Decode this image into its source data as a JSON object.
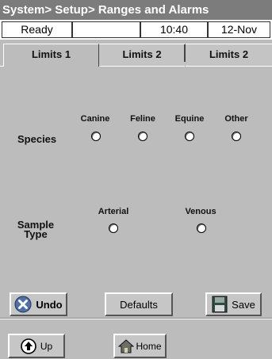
{
  "title": "System> Setup> Ranges and Alarms",
  "status": {
    "state": "Ready",
    "blank": "",
    "time": "10:40",
    "date": "12-Nov"
  },
  "tabs": [
    {
      "label": "Limits 1",
      "active": true
    },
    {
      "label": "Limits 2",
      "active": false
    },
    {
      "label": "Limits 2",
      "active": false
    }
  ],
  "species": {
    "label": "Species",
    "options": [
      "Canine",
      "Feline",
      "Equine",
      "Other"
    ]
  },
  "sample_type": {
    "label_line1": "Sample",
    "label_line2": "Type",
    "options": [
      "Arterial",
      "Venous"
    ]
  },
  "actions": {
    "undo": "Undo",
    "defaults": "Defaults",
    "save": "Save"
  },
  "nav": {
    "up": "Up",
    "home": "Home"
  },
  "icons": {
    "undo": "x-circle-icon",
    "save": "floppy-disk-icon",
    "up": "up-arrow-circle-icon",
    "home": "house-icon"
  }
}
